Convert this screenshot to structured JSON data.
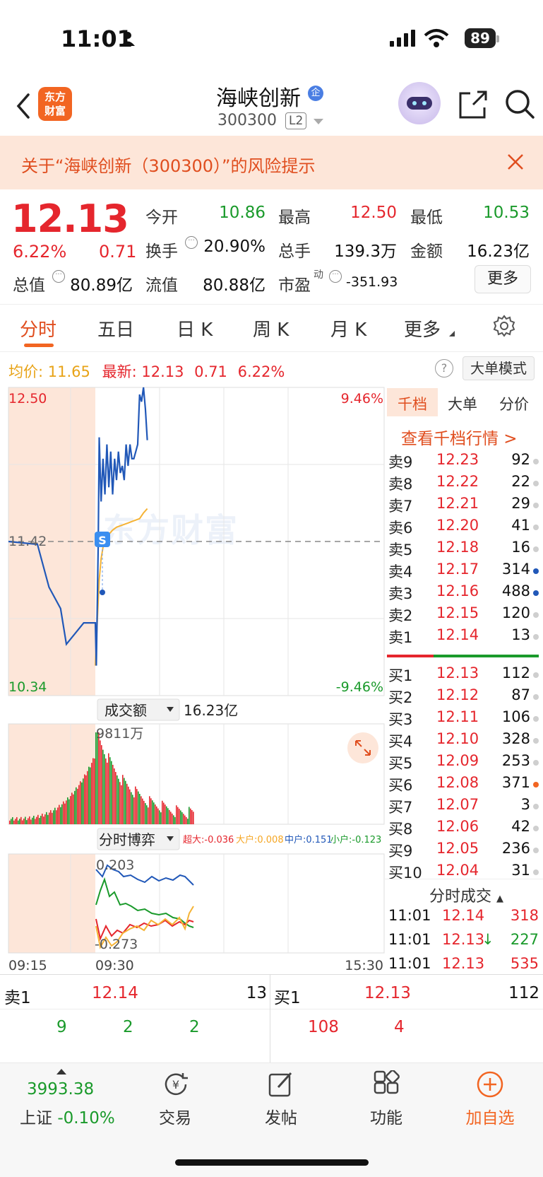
{
  "status_bar": {
    "time": "11:01",
    "battery": "89"
  },
  "header": {
    "logo_text": "东方\n财富",
    "stock_name": "海峡创新",
    "badge": "企",
    "stock_code": "300300",
    "level": "L2"
  },
  "risk_banner": {
    "text": "关于“海峡创新（300300）”的风险提示"
  },
  "quote": {
    "price": "12.13",
    "change_pct": "6.22%",
    "change": "0.71",
    "open_label": "今开",
    "open": "10.86",
    "high_label": "最高",
    "high": "12.50",
    "low_label": "最低",
    "low": "10.53",
    "turnover_label": "换手",
    "turnover": "20.90%",
    "volume_label": "总手",
    "volume": "139.3万",
    "amount_label": "金额",
    "amount": "16.23亿",
    "total_cap_label": "总值",
    "total_cap": "80.89亿",
    "float_cap_label": "流值",
    "float_cap": "80.88亿",
    "pe_label": "市盈",
    "pe_sup": "动",
    "pe": "-351.93",
    "more": "更多"
  },
  "tabs": [
    "分时",
    "五日",
    "日 K",
    "周 K",
    "月 K",
    "更多"
  ],
  "info_row": {
    "avg_label": "均价:",
    "avg": "11.65",
    "latest_label": "最新:",
    "latest": "12.13",
    "change": "0.71",
    "change_pct": "6.22%",
    "help": "?",
    "big_order_mode": "大单模式"
  },
  "chart_labels": {
    "price_high": "12.50",
    "price_low": "10.34",
    "pct_high": "9.46%",
    "pct_low": "-9.46%",
    "mid": "11.42",
    "s_marker": "S",
    "volume_selector": "成交额",
    "volume_total": "16.23亿",
    "volume_max": "9811万",
    "game_selector": "分时博弈",
    "super_large": "超大:-0.036",
    "large": "大户:0.008",
    "medium": "中户:0.151",
    "small": "小户:-0.123",
    "game_high": "0.203",
    "game_low": "-0.273",
    "time_start": "09:15",
    "time_open": "09:30",
    "time_end": "15:30",
    "watermark": "东方财富"
  },
  "colors": {
    "up": "#e5262d",
    "down": "#1a9a2b",
    "price_line": "#2158b8",
    "avg_line": "#f5b335",
    "accent": "#f26522"
  },
  "chart_data": {
    "type": "line",
    "title": "",
    "y_range": [
      10.34,
      12.5
    ],
    "pct_range": [
      -9.46,
      9.46
    ],
    "prev_close": 11.42,
    "series": [
      {
        "name": "最新",
        "x": [
          "09:15",
          "09:20",
          "09:22",
          "09:24",
          "09:25",
          "09:28",
          "09:30",
          "09:31",
          "09:32",
          "09:33",
          "09:34",
          "09:36",
          "09:38",
          "09:40",
          "09:42",
          "09:44",
          "09:46",
          "09:48",
          "09:50",
          "09:52",
          "09:54",
          "09:56",
          "09:58",
          "10:00",
          "10:02",
          "10:04",
          "10:06",
          "10:08",
          "10:10",
          "10:12",
          "10:14",
          "10:16",
          "10:18",
          "10:20",
          "10:22",
          "10:24"
        ],
        "values": [
          11.42,
          11.4,
          11.1,
          10.95,
          10.7,
          10.85,
          10.85,
          10.55,
          10.95,
          11.4,
          12.15,
          11.7,
          12.0,
          11.75,
          12.1,
          11.8,
          12.05,
          11.75,
          12.0,
          11.85,
          12.05,
          11.9,
          11.95,
          11.85,
          12.1,
          11.95,
          12.1,
          12.0,
          12.0,
          12.05,
          12.1,
          12.45,
          12.4,
          12.5,
          12.35,
          12.13
        ]
      },
      {
        "name": "均价",
        "x": [
          "09:30",
          "09:32",
          "09:34",
          "09:36",
          "09:38",
          "09:40",
          "09:44",
          "09:48",
          "09:52",
          "09:56",
          "10:00",
          "10:04",
          "10:08",
          "10:12",
          "10:16",
          "10:20",
          "10:24"
        ],
        "values": [
          10.55,
          10.85,
          11.15,
          11.3,
          11.38,
          11.43,
          11.47,
          11.5,
          11.52,
          11.53,
          11.54,
          11.55,
          11.56,
          11.57,
          11.58,
          11.62,
          11.65
        ]
      }
    ]
  },
  "right_panel": {
    "tabs": [
      "千档",
      "大单",
      "分价"
    ],
    "view_link": "查看千档行情 >",
    "asks": [
      {
        "label": "卖9",
        "price": "12.23",
        "vol": "92",
        "dot": "#cfcfcf"
      },
      {
        "label": "卖8",
        "price": "12.22",
        "vol": "22",
        "dot": "#cfcfcf"
      },
      {
        "label": "卖7",
        "price": "12.21",
        "vol": "29",
        "dot": "#cfcfcf"
      },
      {
        "label": "卖6",
        "price": "12.20",
        "vol": "41",
        "dot": "#cfcfcf"
      },
      {
        "label": "卖5",
        "price": "12.18",
        "vol": "16",
        "dot": "#cfcfcf"
      },
      {
        "label": "卖4",
        "price": "12.17",
        "vol": "314",
        "dot": "#2158b8"
      },
      {
        "label": "卖3",
        "price": "12.16",
        "vol": "488",
        "dot": "#2158b8"
      },
      {
        "label": "卖2",
        "price": "12.15",
        "vol": "120",
        "dot": "#cfcfcf"
      },
      {
        "label": "卖1",
        "price": "12.14",
        "vol": "13",
        "dot": "#cfcfcf"
      }
    ],
    "bids": [
      {
        "label": "买1",
        "price": "12.13",
        "vol": "112",
        "dot": "#cfcfcf"
      },
      {
        "label": "买2",
        "price": "12.12",
        "vol": "87",
        "dot": "#cfcfcf"
      },
      {
        "label": "买3",
        "price": "12.11",
        "vol": "106",
        "dot": "#cfcfcf"
      },
      {
        "label": "买4",
        "price": "12.10",
        "vol": "328",
        "dot": "#cfcfcf"
      },
      {
        "label": "买5",
        "price": "12.09",
        "vol": "253",
        "dot": "#cfcfcf"
      },
      {
        "label": "买6",
        "price": "12.08",
        "vol": "371",
        "dot": "#f26522"
      },
      {
        "label": "买7",
        "price": "12.07",
        "vol": "3",
        "dot": "#cfcfcf"
      },
      {
        "label": "买8",
        "price": "12.06",
        "vol": "42",
        "dot": "#cfcfcf"
      },
      {
        "label": "买9",
        "price": "12.05",
        "vol": "236",
        "dot": "#cfcfcf"
      },
      {
        "label": "买10",
        "price": "12.04",
        "vol": "31",
        "dot": "#cfcfcf"
      }
    ],
    "ticks_header": "分时成交",
    "ticks": [
      {
        "time": "11:01",
        "price": "12.14",
        "vol": "318",
        "arrow": ""
      },
      {
        "time": "11:01",
        "price": "12.13",
        "vol": "227",
        "arrow": "↓"
      },
      {
        "time": "11:01",
        "price": "12.13",
        "vol": "535",
        "arrow": ""
      }
    ]
  },
  "summary": {
    "ask_label": "卖1",
    "ask_price": "12.14",
    "ask_vol": "13",
    "bid_label": "买1",
    "bid_price": "12.13",
    "bid_vol": "112",
    "ask_counts": [
      "9",
      "2",
      "2"
    ],
    "bid_counts": [
      "108",
      "4"
    ]
  },
  "nav": {
    "index_value": "3993.38",
    "index_name": "上证",
    "index_change": "-0.10%",
    "trade": "交易",
    "post": "发帖",
    "functions": "功能",
    "watchlist": "加自选"
  }
}
